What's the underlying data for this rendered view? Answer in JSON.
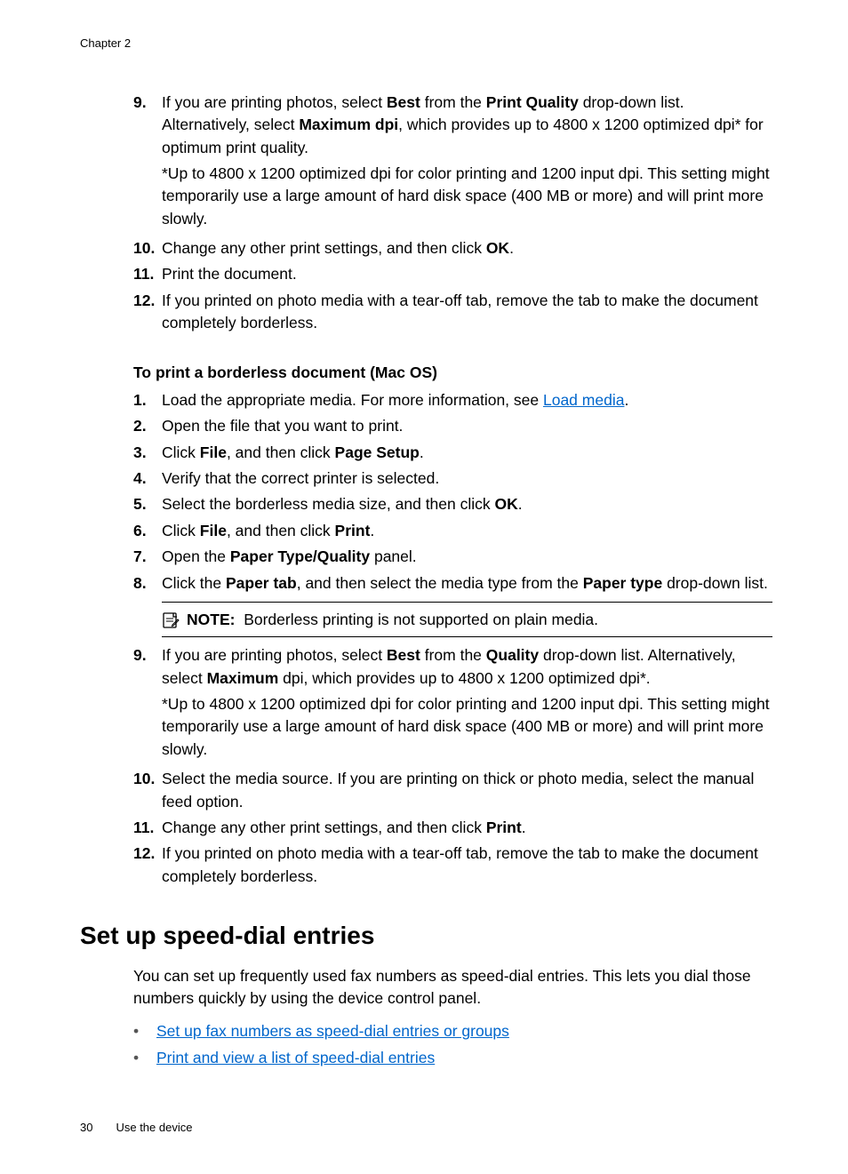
{
  "chapter_label": "Chapter 2",
  "list1": {
    "i9": {
      "num": "9.",
      "t1": "If you are printing photos, select ",
      "b1": "Best",
      "t2": " from the ",
      "b2": "Print Quality",
      "t3": " drop-down list. Alternatively, select ",
      "b3": "Maximum dpi",
      "t4": ", which provides up to 4800 x 1200 optimized dpi* for optimum print quality.",
      "para2": "*Up to 4800 x 1200 optimized dpi for color printing and 1200 input dpi. This setting might temporarily use a large amount of hard disk space (400 MB or more) and will print more slowly."
    },
    "i10": {
      "num": "10.",
      "t1": "Change any other print settings, and then click ",
      "b1": "OK",
      "t2": "."
    },
    "i11": {
      "num": "11.",
      "t1": "Print the document."
    },
    "i12": {
      "num": "12.",
      "t1": "If you printed on photo media with a tear-off tab, remove the tab to make the document completely borderless."
    }
  },
  "subhead_mac": "To print a borderless document (Mac OS)",
  "list2": {
    "i1": {
      "num": "1.",
      "t1": "Load the appropriate media. For more information, see ",
      "link": "Load media",
      "t2": "."
    },
    "i2": {
      "num": "2.",
      "t1": "Open the file that you want to print."
    },
    "i3": {
      "num": "3.",
      "t1": "Click ",
      "b1": "File",
      "t2": ", and then click ",
      "b2": "Page Setup",
      "t3": "."
    },
    "i4": {
      "num": "4.",
      "t1": "Verify that the correct printer is selected."
    },
    "i5": {
      "num": "5.",
      "t1": "Select the borderless media size, and then click ",
      "b1": "OK",
      "t2": "."
    },
    "i6": {
      "num": "6.",
      "t1": "Click ",
      "b1": "File",
      "t2": ", and then click ",
      "b2": "Print",
      "t3": "."
    },
    "i7": {
      "num": "7.",
      "t1": "Open the ",
      "b1": "Paper Type/Quality",
      "t2": " panel."
    },
    "i8": {
      "num": "8.",
      "t1": "Click the ",
      "b1": "Paper tab",
      "t2": ", and then select the media type from the ",
      "b2": "Paper type",
      "t3": " drop-down list."
    },
    "note": {
      "label": "NOTE:",
      "text": "Borderless printing is not supported on plain media."
    },
    "i9": {
      "num": "9.",
      "t1": "If you are printing photos, select ",
      "b1": "Best",
      "t2": " from the ",
      "b2": "Quality",
      "t3": " drop-down list. Alternatively, select ",
      "b3": "Maximum",
      "t4": " dpi, which provides up to 4800 x 1200 optimized dpi*.",
      "para2": "*Up to 4800 x 1200 optimized dpi for color printing and 1200 input dpi. This setting might temporarily use a large amount of hard disk space (400 MB or more) and will print more slowly."
    },
    "i10": {
      "num": "10.",
      "t1": "Select the media source. If you are printing on thick or photo media, select the manual feed option."
    },
    "i11": {
      "num": "11.",
      "t1": "Change any other print settings, and then click ",
      "b1": "Print",
      "t2": "."
    },
    "i12": {
      "num": "12.",
      "t1": "If you printed on photo media with a tear-off tab, remove the tab to make the document completely borderless."
    }
  },
  "h2_speeddial": "Set up speed-dial entries",
  "intro_speeddial": "You can set up frequently used fax numbers as speed-dial entries. This lets you dial those numbers quickly by using the device control panel.",
  "bullets": {
    "b1": "Set up fax numbers as speed-dial entries or groups",
    "b2": "Print and view a list of speed-dial entries"
  },
  "footer": {
    "page": "30",
    "title": "Use the device"
  }
}
